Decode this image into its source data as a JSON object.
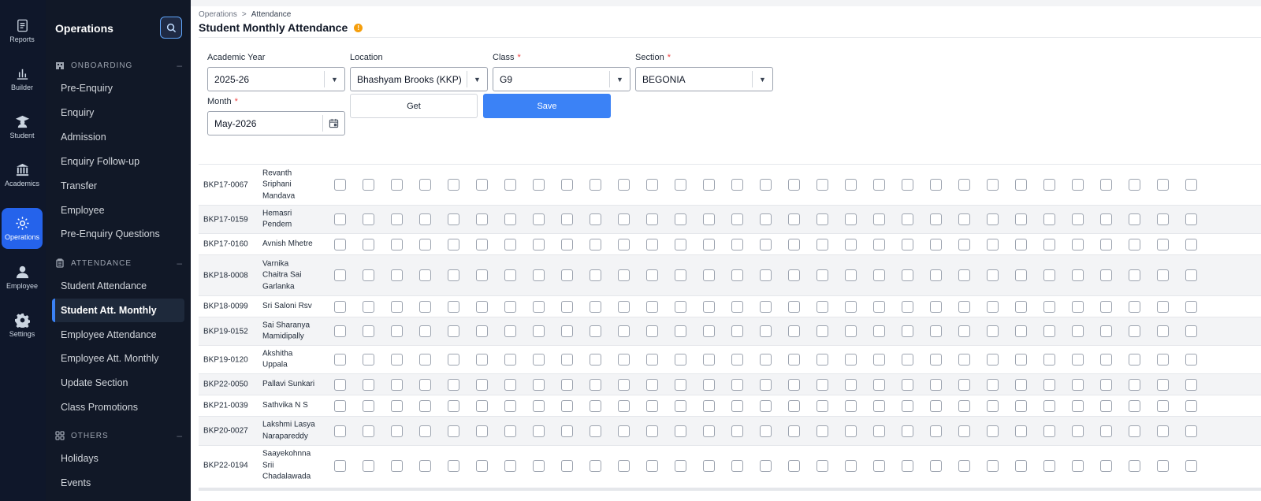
{
  "rail": [
    {
      "icon": "reports-icon",
      "label": "Reports"
    },
    {
      "icon": "builder-icon",
      "label": "Builder"
    },
    {
      "icon": "student-icon",
      "label": "Student"
    },
    {
      "icon": "academics-icon",
      "label": "Academics"
    },
    {
      "icon": "operations-icon",
      "label": "Operations",
      "active": true
    },
    {
      "icon": "employee-icon",
      "label": "Employee"
    },
    {
      "icon": "settings-icon",
      "label": "Settings"
    }
  ],
  "nav": {
    "title": "Operations",
    "sections": [
      {
        "label": "ONBOARDING",
        "icon": "building-icon",
        "items": [
          "Pre-Enquiry",
          "Enquiry",
          "Admission",
          "Enquiry Follow-up",
          "Transfer",
          "Employee",
          "Pre-Enquiry Questions"
        ]
      },
      {
        "label": "ATTENDANCE",
        "icon": "clipboard-icon",
        "items": [
          "Student Attendance",
          "Student Att. Monthly",
          "Employee Attendance",
          "Employee Att. Monthly",
          "Update Section",
          "Class Promotions"
        ]
      },
      {
        "label": "OTHERS",
        "icon": "grid-icon",
        "items": [
          "Holidays",
          "Events"
        ]
      }
    ],
    "active_item": "Student Att. Monthly"
  },
  "breadcrumb": {
    "parent": "Operations",
    "separator": ">",
    "current": "Attendance"
  },
  "page": {
    "title": "Student Monthly Attendance",
    "info": "!"
  },
  "filters": {
    "academic_year": {
      "label": "Academic Year",
      "value": "2025-26"
    },
    "location": {
      "label": "Location",
      "value": "Bhashyam Brooks (KKP)"
    },
    "class": {
      "label": "Class",
      "value": "G9",
      "required": "*"
    },
    "section": {
      "label": "Section",
      "value": "BEGONIA",
      "required": "*"
    },
    "month": {
      "label": "Month",
      "value": "May-2026",
      "required": "*"
    },
    "get_label": "Get",
    "save_label": "Save",
    "arrow": "▼"
  },
  "checkbox_columns": 31,
  "rows": [
    {
      "id": "BKP17-0067",
      "name": [
        "Revanth",
        "Sriphani",
        "Mandava"
      ]
    },
    {
      "id": "BKP17-0159",
      "name": [
        "Hemasri",
        "Pendem"
      ]
    },
    {
      "id": "BKP17-0160",
      "name": [
        "Avnish Mhetre"
      ]
    },
    {
      "id": "BKP18-0008",
      "name": [
        "Varnika",
        "Chaitra Sai",
        "Garlanka"
      ]
    },
    {
      "id": "BKP18-0099",
      "name": [
        "Sri Saloni Rsv"
      ]
    },
    {
      "id": "BKP19-0152",
      "name": [
        "Sai Sharanya",
        "Mamidipally"
      ]
    },
    {
      "id": "BKP19-0120",
      "name": [
        "Akshitha",
        "Uppala"
      ]
    },
    {
      "id": "BKP22-0050",
      "name": [
        "Pallavi Sunkari"
      ]
    },
    {
      "id": "BKP21-0039",
      "name": [
        "Sathvika N S"
      ]
    },
    {
      "id": "BKP20-0027",
      "name": [
        "Lakshmi Lasya",
        "Narapareddy"
      ]
    },
    {
      "id": "BKP22-0194",
      "name": [
        "Saayekohnna",
        "Srii",
        "Chadalawada"
      ]
    }
  ]
}
